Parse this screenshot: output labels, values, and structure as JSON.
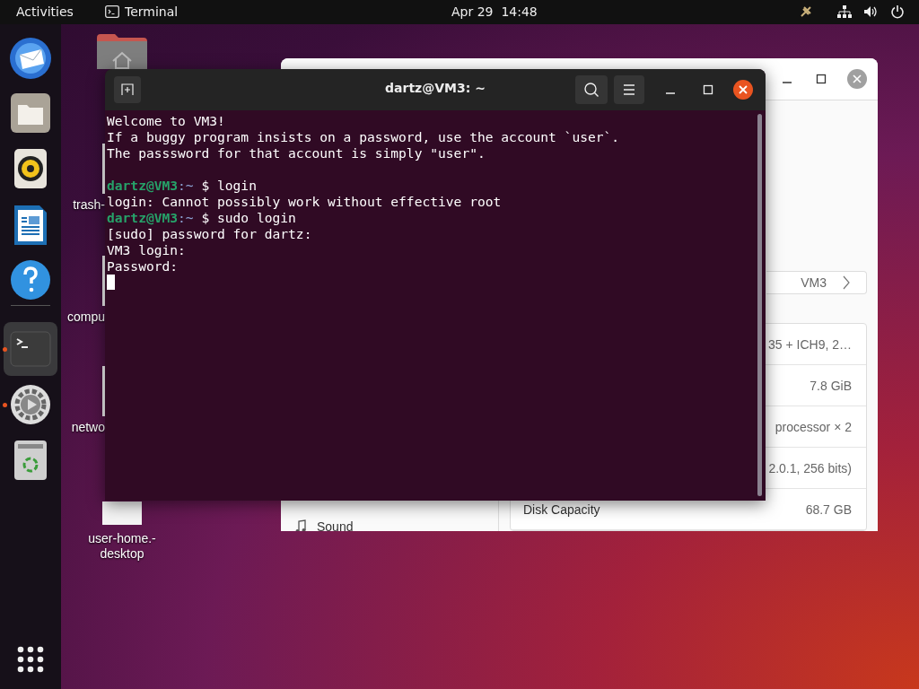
{
  "top_bar": {
    "activities": "Activities",
    "app_name": "Terminal",
    "clock": "Apr 29  14:48"
  },
  "dock": {
    "items": [
      {
        "kind": "mail",
        "running": false,
        "selected": false
      },
      {
        "kind": "files",
        "running": false,
        "selected": false
      },
      {
        "kind": "audio",
        "running": false,
        "selected": false
      },
      {
        "kind": "document",
        "running": false,
        "selected": false
      },
      {
        "kind": "help",
        "running": false,
        "selected": false
      },
      {
        "kind": "terminal",
        "running": true,
        "selected": true
      },
      {
        "kind": "settings",
        "running": true,
        "selected": false
      },
      {
        "kind": "trash",
        "running": false,
        "selected": false
      }
    ]
  },
  "desktop_icons": [
    {
      "kind": "home"
    },
    {
      "kind": "file",
      "label_lines": [
        "trash-"
      ]
    },
    {
      "kind": "file",
      "label_lines": [
        "compu"
      ]
    },
    {
      "kind": "file",
      "label_lines": [
        "netwo"
      ]
    },
    {
      "kind": "file",
      "label_lines": [
        "user-home.-",
        "desktop"
      ]
    }
  ],
  "settings_window": {
    "hostname_row": {
      "value": "VM3"
    },
    "info_rows": [
      {
        "value": "35 + ICH9, 2…"
      },
      {
        "value": "7.8 GiB"
      },
      {
        "value": "processor × 2"
      },
      {
        "value": "2.0.1, 256 bits)"
      },
      {
        "label": "Disk Capacity",
        "value": "68.7 GB"
      }
    ],
    "sidebar_items": [
      {
        "label": "Sound"
      }
    ]
  },
  "terminal": {
    "title": "dartz@VM3: ~",
    "lines": [
      {
        "kind": "output",
        "text": "Welcome to VM3!"
      },
      {
        "kind": "output",
        "text": "If a buggy program insists on a password, use the account `user`."
      },
      {
        "kind": "output",
        "text": "The passsword for that account is simply \"user\"."
      },
      {
        "kind": "blank"
      },
      {
        "kind": "prompt",
        "user": "dartz@VM3",
        "path": ":~",
        "command": "$ login"
      },
      {
        "kind": "output",
        "text": "login: Cannot possibly work without effective root"
      },
      {
        "kind": "prompt",
        "user": "dartz@VM3",
        "path": ":~",
        "command": "$ sudo login"
      },
      {
        "kind": "output",
        "text": "[sudo] password for dartz:"
      },
      {
        "kind": "output",
        "text": "VM3 login:"
      },
      {
        "kind": "output",
        "text": "Password:"
      },
      {
        "kind": "cursor"
      }
    ]
  }
}
